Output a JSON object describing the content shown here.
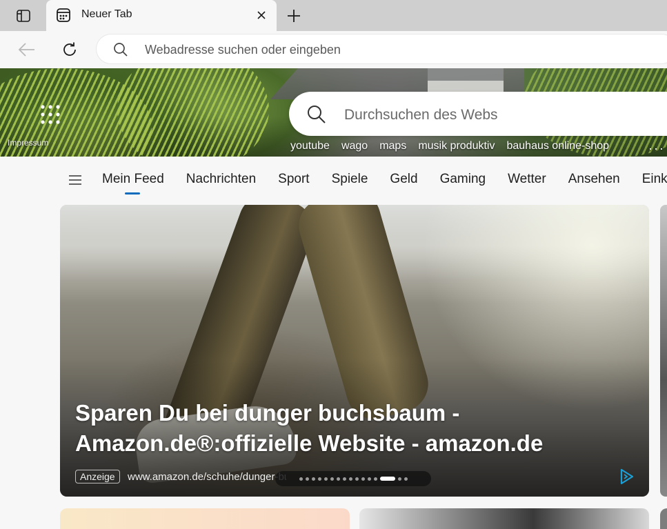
{
  "browser": {
    "tab": {
      "title": "Neuer Tab"
    },
    "address_bar": {
      "placeholder": "Webadresse suchen oder eingeben"
    }
  },
  "hero": {
    "impressum_label": "Impressum",
    "search": {
      "placeholder": "Durchsuchen des Webs"
    },
    "quick_links": [
      "youtube",
      "wago",
      "maps",
      "musik produktiv",
      "bauhaus online-shop"
    ],
    "more_label": "···"
  },
  "feed_nav": {
    "tabs": [
      "Mein Feed",
      "Nachrichten",
      "Sport",
      "Spiele",
      "Geld",
      "Gaming",
      "Wetter",
      "Ansehen",
      "Eink"
    ],
    "active_tab": "Mein Feed"
  },
  "ad_card": {
    "title_line1": "Sparen Du bei dunger buchsbaum -",
    "title_line2": "Amazon.de®:offizielle Website - amazon.de",
    "badge": "Anzeige",
    "url": "www.amazon.de/schuhe/dunger-buchsbaum",
    "carousel": {
      "total": 16,
      "active_index": 13
    }
  },
  "colors": {
    "accent": "#0f6cbd",
    "tabstrip": "#cfcfcf",
    "page_bg": "#f7f7f7",
    "adchoice": "#1aa0d8"
  }
}
